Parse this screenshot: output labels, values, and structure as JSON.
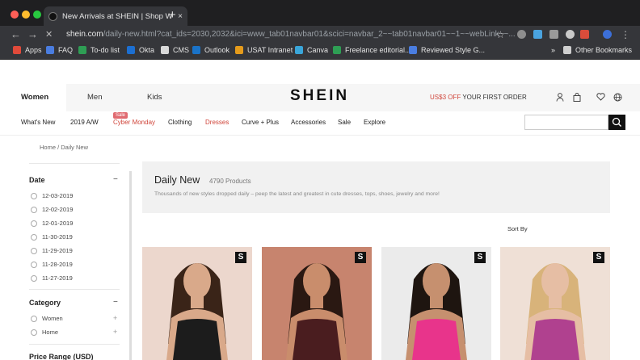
{
  "browser": {
    "tab_title": "New Arrivals at SHEIN | Shop W",
    "tab_close": "×",
    "new_tab": "+",
    "back": "←",
    "forward": "→",
    "reload": "✕",
    "url_host": "shein.com",
    "url_path": "/daily-new.html?cat_ids=2030,2032&ici=www_tab01navbar01&scici=navbar_2~~tab01navbar01~~1~~webLink~~...",
    "bookmarks": [
      {
        "label": "Apps",
        "color": "#e04a3a"
      },
      {
        "label": "FAQ",
        "color": "#4a7de0"
      },
      {
        "label": "To-do list",
        "color": "#2e9e54"
      },
      {
        "label": "Okta",
        "color": "#1c6fd1"
      },
      {
        "label": "CMS",
        "color": "#d9d9d9"
      },
      {
        "label": "Outlook",
        "color": "#1a73c8"
      },
      {
        "label": "USAT Intranet",
        "color": "#e59b1b"
      },
      {
        "label": "Canva",
        "color": "#3aa6d9"
      },
      {
        "label": "Freelance editorial...",
        "color": "#2e9e54"
      },
      {
        "label": "Reviewed Style G...",
        "color": "#4a7de0"
      }
    ],
    "bookmarks_overflow": "»",
    "other_bookmarks": "Other Bookmarks"
  },
  "site": {
    "logo": "SHEIN",
    "categories": [
      "Women",
      "Men",
      "Kids"
    ],
    "promo_highlight": "US$3 OFF",
    "promo_text": "YOUR FIRST ORDER",
    "menu": [
      {
        "label": "What's New",
        "highlight": false
      },
      {
        "label": "2019 A/W",
        "highlight": false
      },
      {
        "label": "Cyber Monday",
        "highlight": true
      },
      {
        "label": "Clothing",
        "highlight": false
      },
      {
        "label": "Dresses",
        "highlight": true
      },
      {
        "label": "Curve + Plus",
        "highlight": false
      },
      {
        "label": "Accessories",
        "highlight": false
      },
      {
        "label": "Sale",
        "highlight": false
      },
      {
        "label": "Explore",
        "highlight": false
      }
    ],
    "sale_badge": "Sale",
    "search_placeholder": ""
  },
  "breadcrumb": "Home  /  Daily New",
  "sidebar": {
    "date_title": "Date",
    "dates": [
      "12-03-2019",
      "12-02-2019",
      "12-01-2019",
      "11-30-2019",
      "11-29-2019",
      "11-28-2019",
      "11-27-2019"
    ],
    "category_title": "Category",
    "categories": [
      "Women",
      "Home"
    ],
    "price_title": "Price Range (USD)",
    "collapse_symbol": "−",
    "expand_symbol": "+"
  },
  "banner": {
    "title": "Daily New",
    "count": "4790 Products",
    "description": "Thousands of new styles dropped daily – peep the latest and greatest in cute dresses, tops, shoes, jewelry and more!"
  },
  "sort_label": "Sort By",
  "products": [
    {
      "badge": "S",
      "bg": "#ecd7cd",
      "outfit": "#1c1c1c",
      "hair": "#3a2418",
      "skin": "#d9a98a"
    },
    {
      "badge": "S",
      "bg": "#c7846e",
      "outfit": "#4a1d1f",
      "hair": "#2a1812",
      "skin": "#c98d6c"
    },
    {
      "badge": "S",
      "bg": "#ebebeb",
      "outfit": "#e8348b",
      "hair": "#1e1510",
      "skin": "#c6906f"
    },
    {
      "badge": "S",
      "bg": "#efe0d6",
      "outfit": "#b0418f",
      "hair": "#d8b37a",
      "skin": "#e6bea4"
    }
  ]
}
